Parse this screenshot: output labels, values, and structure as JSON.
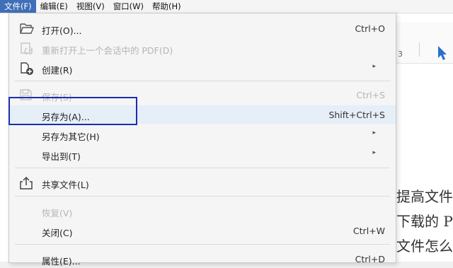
{
  "menubar": {
    "items": [
      {
        "label": "文件(F)"
      },
      {
        "label": "编辑(E)"
      },
      {
        "label": "视图(V)"
      },
      {
        "label": "窗口(W)"
      },
      {
        "label": "帮助(H)"
      }
    ]
  },
  "document": {
    "page_indicator": "3",
    "lines": [
      "提高文件",
      "下载的 P",
      "文件怎么"
    ]
  },
  "file_menu": {
    "items": [
      {
        "label": "打开(O)...",
        "shortcut": "Ctrl+O",
        "icon": "folder-open-icon",
        "enabled": true
      },
      {
        "label": "重新打开上一个会话中的 PDF(D)",
        "shortcut": "",
        "icon": "reopen-session-icon",
        "enabled": false
      },
      {
        "label": "创建(R)",
        "shortcut": "",
        "icon": "create-pdf-icon",
        "enabled": true,
        "submenu": true
      },
      {
        "label": "保存(S)",
        "shortcut": "Ctrl+S",
        "icon": "save-icon",
        "enabled": false
      },
      {
        "label": "另存为(A)...",
        "shortcut": "Shift+Ctrl+S",
        "icon": "",
        "enabled": true,
        "highlighted": true
      },
      {
        "label": "另存为其它(H)",
        "shortcut": "",
        "icon": "",
        "enabled": true,
        "submenu": true
      },
      {
        "label": "导出到(T)",
        "shortcut": "",
        "icon": "",
        "enabled": true,
        "submenu": true
      },
      {
        "label": "共享文件(L)",
        "shortcut": "",
        "icon": "share-icon",
        "enabled": true
      },
      {
        "label": "恢复(V)",
        "shortcut": "",
        "icon": "",
        "enabled": false
      },
      {
        "label": "关闭(C)",
        "shortcut": "Ctrl+W",
        "icon": "",
        "enabled": true
      },
      {
        "label": "属性(E)...",
        "shortcut": "Ctrl+D",
        "icon": "",
        "enabled": true
      }
    ]
  },
  "colors": {
    "highlight_box": "#1b2fb0",
    "active_menu": "#3f6fb8",
    "cursor_tool": "#2a6fcf"
  }
}
